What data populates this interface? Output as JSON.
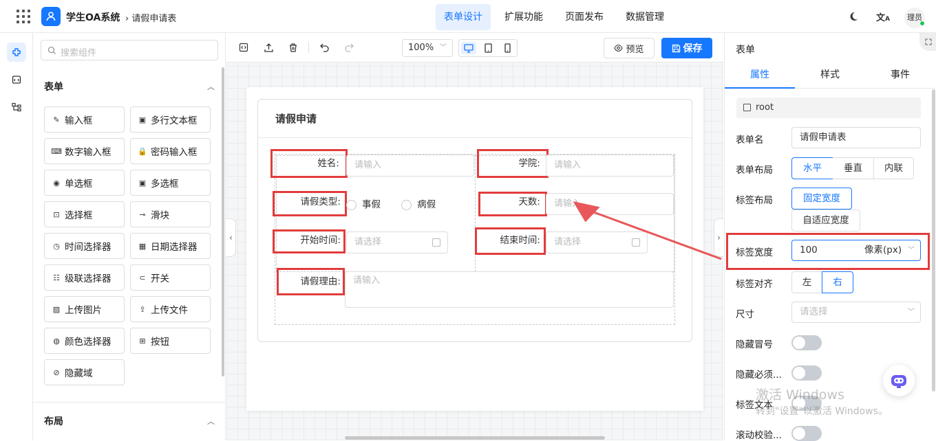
{
  "header": {
    "app_title": "学生OA系统",
    "breadcrumb": "› 请假申请表",
    "nav": [
      {
        "label": "表单设计",
        "active": true
      },
      {
        "label": "扩展功能",
        "active": false
      },
      {
        "label": "页面发布",
        "active": false
      },
      {
        "label": "数据管理",
        "active": false
      }
    ],
    "avatar_text": "理员",
    "icons": [
      "apps-grid-icon",
      "user-logo-icon",
      "moon-icon",
      "translate-icon"
    ]
  },
  "components": {
    "search_placeholder": "搜索组件",
    "form_section": "表单",
    "items": [
      {
        "label": "输入框",
        "icon": "✎"
      },
      {
        "label": "多行文本框",
        "icon": "▣"
      },
      {
        "label": "数字输入框",
        "icon": "⌨"
      },
      {
        "label": "密码输入框",
        "icon": "🔒"
      },
      {
        "label": "单选框",
        "icon": "◉"
      },
      {
        "label": "多选框",
        "icon": "▣"
      },
      {
        "label": "选择框",
        "icon": "⊡"
      },
      {
        "label": "滑块",
        "icon": "⊸"
      },
      {
        "label": "时间选择器",
        "icon": "◷"
      },
      {
        "label": "日期选择器",
        "icon": "▦"
      },
      {
        "label": "级联选择器",
        "icon": "☷"
      },
      {
        "label": "开关",
        "icon": "⊂"
      },
      {
        "label": "上传图片",
        "icon": "▨"
      },
      {
        "label": "上传文件",
        "icon": "⇪"
      },
      {
        "label": "颜色选择器",
        "icon": "◍"
      },
      {
        "label": "按钮",
        "icon": "⊞"
      },
      {
        "label": "隐藏域",
        "icon": "⊘"
      }
    ],
    "layout_section": "布局"
  },
  "toolbar": {
    "zoom": "100%",
    "preview_label": "预览",
    "save_label": "保存"
  },
  "form": {
    "title": "请假申请",
    "fields": {
      "name": {
        "label": "姓名:",
        "placeholder": "请输入"
      },
      "college": {
        "label": "学院:",
        "placeholder": "请输入"
      },
      "leave_type": {
        "label": "请假类型:",
        "options": [
          "事假",
          "病假"
        ]
      },
      "days": {
        "label": "天数:",
        "placeholder": "请输入"
      },
      "start_time": {
        "label": "开始时间:",
        "placeholder": "请选择"
      },
      "end_time": {
        "label": "结束时间:",
        "placeholder": "请选择"
      },
      "reason": {
        "label": "请假理由:",
        "placeholder": "请输入"
      }
    }
  },
  "properties": {
    "panel_title": "表单",
    "tabs": [
      "属性",
      "样式",
      "事件"
    ],
    "active_tab": "属性",
    "root_label": "root",
    "form_name_label": "表单名",
    "form_name_value": "请假申请表",
    "form_layout_label": "表单布局",
    "form_layout_options": [
      "水平",
      "垂直",
      "内联"
    ],
    "label_layout_label": "标签布局",
    "label_layout_options": [
      "固定宽度",
      "自适应宽度"
    ],
    "label_width_label": "标签宽度",
    "label_width_value": "100",
    "label_width_unit": "像素(px)",
    "label_align_label": "标签对齐",
    "label_align_options": [
      "左",
      "右"
    ],
    "size_label": "尺寸",
    "size_placeholder": "请选择",
    "hide_colon_label": "隐藏冒号",
    "hide_required_label": "隐藏必须...",
    "label_text_label": "标签文本",
    "scroll_validate_label": "滚动校验...",
    "accent_color": "#1677ff",
    "highlight_color": "#e23c3c"
  },
  "watermark": {
    "line1": "激活 Windows",
    "line2": "转到\"设置\"以激活 Windows。"
  }
}
